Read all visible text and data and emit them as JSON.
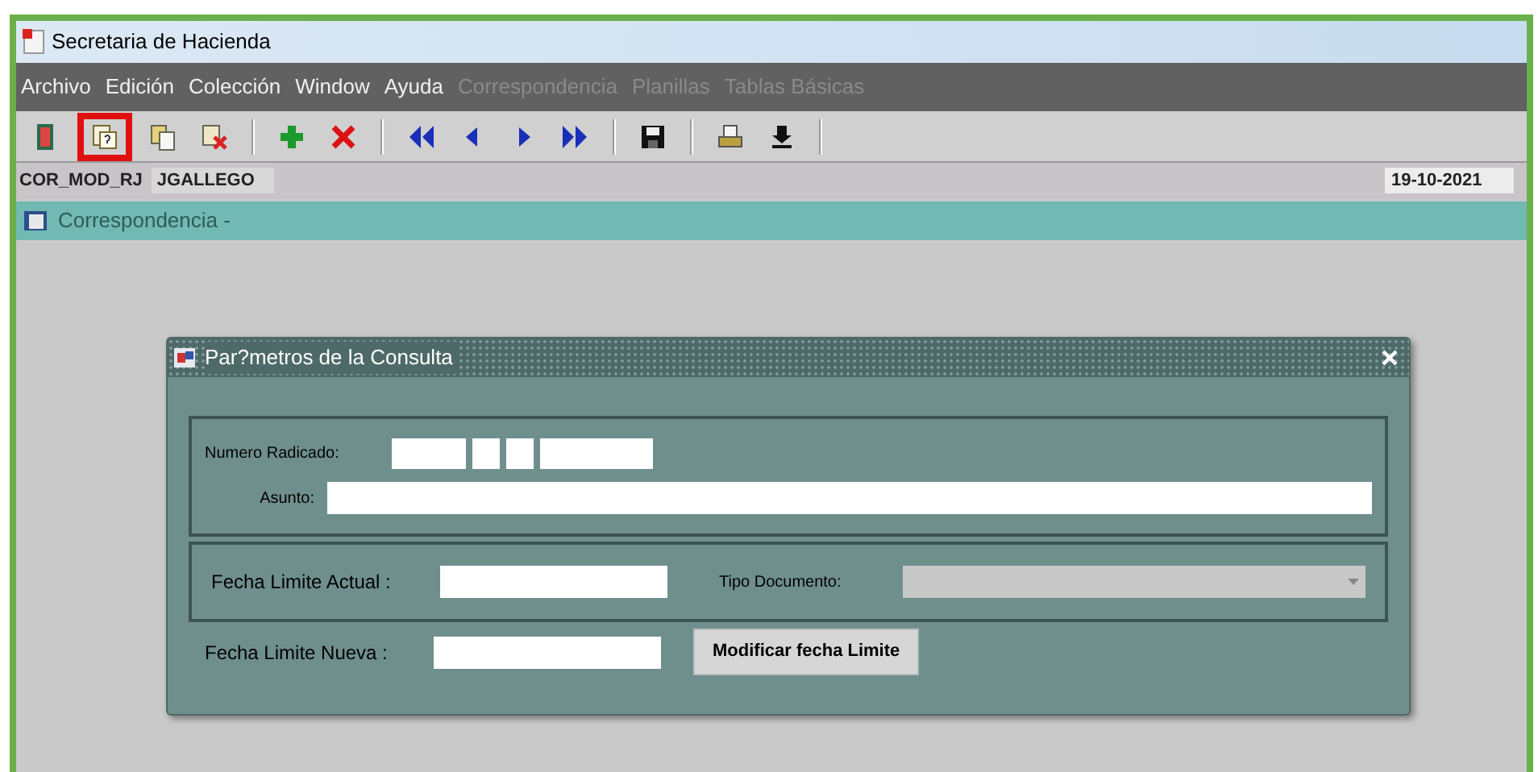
{
  "window": {
    "title": "Secretaria de Hacienda"
  },
  "menu": [
    {
      "label": "Archivo",
      "disabled": false
    },
    {
      "label": "Edición",
      "disabled": false
    },
    {
      "label": "Colección",
      "disabled": false
    },
    {
      "label": "Window",
      "disabled": false
    },
    {
      "label": "Ayuda",
      "disabled": false
    },
    {
      "label": "Correspondencia",
      "disabled": true
    },
    {
      "label": "Planillas",
      "disabled": true
    },
    {
      "label": "Tablas Básicas",
      "disabled": true
    }
  ],
  "toolbar": [
    {
      "kind": "exit",
      "highlighted": false
    },
    {
      "kind": "query",
      "highlighted": true
    },
    {
      "kind": "copy",
      "highlighted": false
    },
    {
      "kind": "clear",
      "highlighted": false
    },
    {
      "kind": "separator"
    },
    {
      "kind": "add",
      "highlighted": false
    },
    {
      "kind": "delete",
      "highlighted": false
    },
    {
      "kind": "separator"
    },
    {
      "kind": "first",
      "highlighted": false
    },
    {
      "kind": "prev",
      "highlighted": false
    },
    {
      "kind": "next",
      "highlighted": false
    },
    {
      "kind": "last",
      "highlighted": false
    },
    {
      "kind": "separator"
    },
    {
      "kind": "save",
      "highlighted": false
    },
    {
      "kind": "separator"
    },
    {
      "kind": "print",
      "highlighted": false
    },
    {
      "kind": "download",
      "highlighted": false
    },
    {
      "kind": "separator"
    }
  ],
  "status_bar": {
    "module": "COR_MOD_RJ",
    "user": "JGALLEGO",
    "date": "19-10-2021"
  },
  "form_bar": {
    "title": "Correspondencia -",
    "disabled": true
  },
  "dialog": {
    "title": "Par?metros de la Consulta",
    "numero_radicado": {
      "label": "Numero Radicado:"
    },
    "asunto": {
      "label": "Asunto:"
    },
    "fecha_limite_actual": {
      "label": "Fecha Limite Actual :"
    },
    "tipo_documento": {
      "label": "Tipo Documento:",
      "disabled": true
    },
    "fecha_limite_nueva": {
      "label": "Fecha Limite Nueva :"
    },
    "button": "Modificar fecha Limite"
  }
}
